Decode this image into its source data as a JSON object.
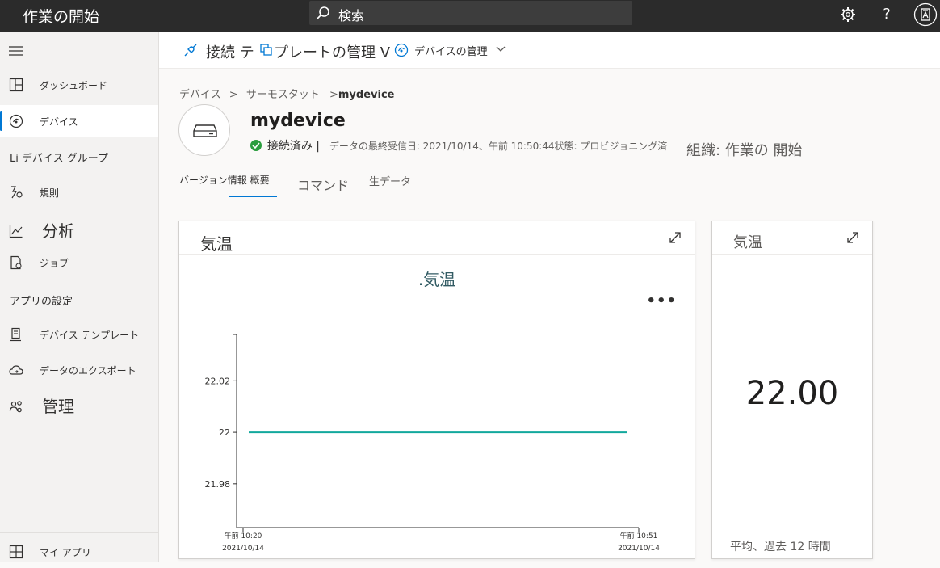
{
  "topbar": {
    "title": "作業の開始",
    "search_text": "検索"
  },
  "sidebar": {
    "items": [
      {
        "label": "ダッシュボード"
      },
      {
        "label": "デバイス"
      },
      {
        "label": "Li デバイス グループ"
      },
      {
        "label": "規則"
      },
      {
        "label": "分析"
      },
      {
        "label": "ジョブ"
      },
      {
        "label": "アプリの設定"
      },
      {
        "label": "デバイス テンプレート"
      },
      {
        "label": "データのエクスポート"
      },
      {
        "label": "管理"
      },
      {
        "label": "マイ アプリ"
      }
    ]
  },
  "cmdbar": {
    "connect_template": "接続 テ",
    "connect_template_rest": "プレートの管理 V",
    "device_manage": "デバイスの管理"
  },
  "breadcrumb": {
    "p1": "デバイス",
    "sep1": ">",
    "p2": "サーモスタット",
    "sep2": ">",
    "current": "mydevice"
  },
  "device": {
    "name": "mydevice",
    "status": "接続済み |",
    "last_received": "データの最終受信日: 2021/10/14、午前 10:50:44状態: プロビジョニング済",
    "org": "組織: 作業の 開始"
  },
  "tabs": {
    "version_overview": "バージョン情報 概要",
    "commands": "コマンド",
    "raw_data": "生データ"
  },
  "card_chart": {
    "title": "気温",
    "chart_title": ".気温",
    "more": "•••"
  },
  "card_kpi": {
    "title": "気温",
    "value": "22.00",
    "footer": "平均、過去 12 時間"
  },
  "chart_data": {
    "type": "line",
    "title": ".気温",
    "xlabel": "",
    "ylabel": "",
    "x_ticks": [
      {
        "line1": "午前 10:20",
        "line2": "2021/10/14"
      },
      {
        "line1": "午前 10:51",
        "line2": "2021/10/14"
      }
    ],
    "y_ticks": [
      22.02,
      22,
      21.98
    ],
    "y_tick_labels": [
      "22.02",
      "22",
      "21.98"
    ],
    "ylim": [
      21.963,
      22.038
    ],
    "series": [
      {
        "x": [
          "午前 10:20",
          "午前 10:51"
        ],
        "values": [
          22,
          22
        ],
        "color": "#12a89d"
      }
    ],
    "grid": false
  },
  "colors": {
    "accent": "#0078d4",
    "series": "#12a89d",
    "status_ok": "#2a9d3e",
    "topbar": "#2b2b2b"
  }
}
